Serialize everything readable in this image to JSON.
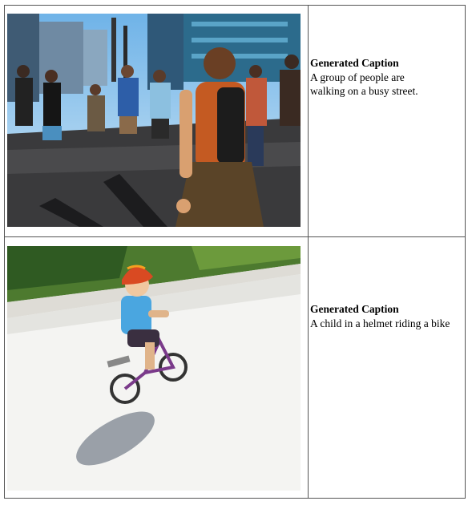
{
  "rows": [
    {
      "caption_title": "Generated Caption",
      "caption_text": "A group of people are\n  walking on a busy street."
    },
    {
      "caption_title": "Generated Caption",
      "caption_text": "A child in a helmet riding a bike"
    }
  ]
}
